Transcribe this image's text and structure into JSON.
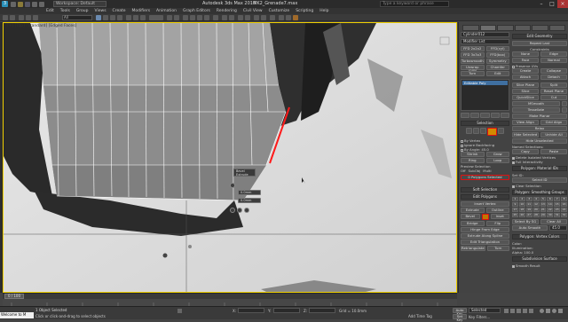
{
  "window": {
    "workspace": "Workspace: Default",
    "app_title": "Autodesk 3ds Max 2016",
    "file_name": "MK2_Grenade7.max",
    "search_placeholder": "Type a keyword or phrase"
  },
  "menu": [
    "Edit",
    "Tools",
    "Group",
    "Views",
    "Create",
    "Modifiers",
    "Animation",
    "Graph Editors",
    "Rendering",
    "Civil View",
    "Customize",
    "Scripting",
    "Help"
  ],
  "toolbar": {
    "filter": "All"
  },
  "viewport": {
    "label": "[+] [Top] [Standard] [Edged Faces]",
    "tooltip": [
      "Bevel",
      "Extrude"
    ],
    "spinner1": "0.0mm",
    "spinner2": "0.0mm"
  },
  "command_panel": {
    "object_name": "Cylinder012",
    "modifier_list": "Modifier List",
    "modifier_buttons": [
      "FFD 2x2x2",
      "FFD 3x3x3",
      "FFD 4x4x4",
      "Turbosmooth",
      "Unwrap UVW",
      "Turn",
      "FFD(box)",
      "FFD(cyl)",
      "Symmetry",
      "Chamfer",
      "Edit"
    ],
    "stack_item": "Editable Poly",
    "selection_header": "Selection",
    "by_vertex": "By Vertex",
    "ignore_backfacing": "Ignore Backfacing",
    "by_angle": "By Angle:",
    "angle_value": "45.0",
    "shrink": "Shrink",
    "grow": "Grow",
    "ring": "Ring",
    "loop": "Loop",
    "preview_selection": "Preview Selection",
    "off": "Off",
    "subobj": "SubObj",
    "multi": "Multi",
    "selected_status": "0 Polygons Selected",
    "soft_selection": "Soft Selection",
    "edit_polygons": "Edit Polygons",
    "insert_vertex": "Insert Vertex",
    "extrude": "Extrude",
    "outline": "Outline",
    "bevel": "Bevel",
    "inset": "Inset",
    "bridge": "Bridge",
    "flip": "Flip",
    "hinge": "Hinge From Edge",
    "extrude_spline": "Extrude Along Spline",
    "edit_triangulation": "Edit Triangulation",
    "retriangulate": "Retriangulate",
    "turn": "Turn",
    "edit_geometry": "Edit Geometry",
    "repeat_last": "Repeat Last",
    "constraints": "Constraints",
    "none": "None",
    "edge": "Edge",
    "face": "Face",
    "normal": "Normal",
    "preserve_uvs": "Preserve UVs",
    "create": "Create",
    "collapse": "Collapse",
    "attach": "Attach",
    "detach": "Detach",
    "slice_plane": "Slice Plane",
    "split": "Split",
    "slice": "Slice",
    "reset_plane": "Reset Plane",
    "quickslice": "QuickSlice",
    "cut": "Cut",
    "msmooth": "MSmooth",
    "tessellate": "Tessellate",
    "make_planar": "Make Planar",
    "view_align": "View Align",
    "grid_align": "Grid Align",
    "relax": "Relax",
    "hide_selected": "Hide Selected",
    "unhide_all": "Unhide All",
    "hide_unselected": "Hide Unselected",
    "named_selections": "Named Selections:",
    "copy": "Copy",
    "paste": "Paste",
    "delete_isolated": "Delete Isolated Vertices",
    "full_interactivity": "Full Interactivity",
    "poly_material_ids": "Polygon: Material IDs",
    "set_id": "Set ID:",
    "select_id": "Select ID",
    "clear_selection": "Clear Selection",
    "smoothing_groups": "Polygon: Smoothing Groups",
    "sg_numbers": [
      "1",
      "2",
      "3",
      "4",
      "5",
      "6",
      "7",
      "8",
      "9",
      "10",
      "11",
      "12",
      "13",
      "14",
      "15",
      "16",
      "17",
      "18",
      "19",
      "20",
      "21",
      "22",
      "23",
      "24",
      "25",
      "26",
      "27",
      "28",
      "29",
      "30",
      "31",
      "32"
    ],
    "select_by_sg": "Select By SG",
    "clear_all": "Clear All",
    "auto_smooth": "Auto Smooth",
    "auto_smooth_value": "45.0",
    "vertex_colors": "Polygon: Vertex Colors",
    "color": "Color:",
    "illumination": "Illumination:",
    "alpha": "Alpha:",
    "alpha_value": "100.0",
    "subdivision_surface": "Subdivision Surface",
    "smooth_result": "Smooth Result"
  },
  "timeline": {
    "frame": "0 / 100"
  },
  "status": {
    "listener": "Welcome to M",
    "objects_selected": "1 Object Selected",
    "hint": "Click or click-and-drag to select objects",
    "auto_key": "Auto Key",
    "selected": "Selected",
    "set_key": "Set Key",
    "key_filters": "Key Filters...",
    "add_time_tag": "Add Time Tag",
    "x_label": "X:",
    "y_label": "Y:",
    "z_label": "Z:",
    "grid": "Grid = 10.0mm"
  }
}
